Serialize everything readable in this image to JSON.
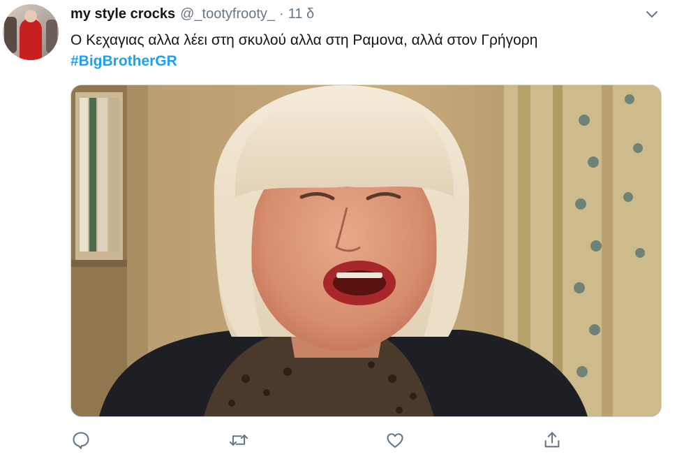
{
  "tweet": {
    "display_name": "my style crocks",
    "handle": "@_tootyfrooty_",
    "separator": "·",
    "time": "11 δ",
    "text": "Ο Κεχαγιας αλλα λέει στη σκυλού αλλα στη Ραμονα, αλλά στον Γρήγορη",
    "hashtag": "#BigBrotherGR"
  },
  "icons": {
    "caret": "chevron-down-icon",
    "reply": "reply-icon",
    "retweet": "retweet-icon",
    "like": "heart-icon",
    "share": "share-icon"
  },
  "colors": {
    "text": "#14171a",
    "secondary": "#657786",
    "link": "#1da1f2"
  }
}
